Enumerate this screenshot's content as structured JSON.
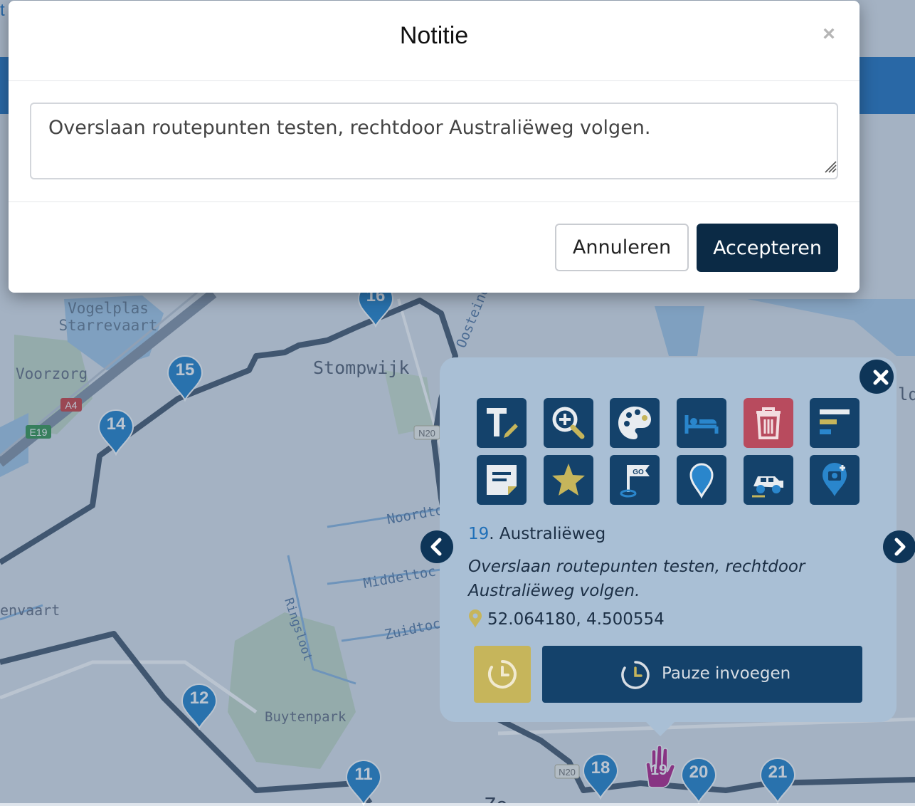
{
  "modal": {
    "title": "Notitie",
    "close_glyph": "×",
    "note_value": "Overslaan routepunten testen, rechtdoor Australiëweg volgen.",
    "cancel_label": "Annuleren",
    "accept_label": "Accepteren"
  },
  "map": {
    "place_labels": {
      "vogelplas_line1": "Vogelplas",
      "vogelplas_line2": "Starrevaart",
      "voorzorg": "Voorzorg",
      "stompwijk": "Stompwijk",
      "oosteinde": "Oosteind",
      "noordtocht": "Noordto",
      "middeltocht": "Middeltoc",
      "zuidtocht": "Zuidtoch",
      "ringsloot": "Ringsloot",
      "buytenpark": "Buytenpark",
      "venvaart": "envaart",
      "edge_ld": "ld",
      "zoet": "Zo"
    },
    "road_shields": {
      "a4": "A4",
      "e19": "E19",
      "n206a": "N20",
      "n206b": "N20"
    },
    "markers": [
      {
        "id": "16",
        "label": "16"
      },
      {
        "id": "15",
        "label": "15"
      },
      {
        "id": "14",
        "label": "14"
      },
      {
        "id": "12",
        "label": "12"
      },
      {
        "id": "11",
        "label": "11"
      },
      {
        "id": "18",
        "label": "18"
      },
      {
        "id": "19",
        "label": "19"
      },
      {
        "id": "20",
        "label": "20"
      },
      {
        "id": "21",
        "label": "21"
      }
    ],
    "top_left_char": "t"
  },
  "popup": {
    "tools": [
      {
        "name": "edit-text-icon"
      },
      {
        "name": "zoom-in-icon"
      },
      {
        "name": "palette-icon"
      },
      {
        "name": "bed-icon"
      },
      {
        "name": "trash-icon"
      },
      {
        "name": "bar-list-icon"
      },
      {
        "name": "note-icon"
      },
      {
        "name": "star-icon"
      },
      {
        "name": "go-flag-icon"
      },
      {
        "name": "map-pin-icon"
      },
      {
        "name": "offroad-jeep-icon"
      },
      {
        "name": "camera-pin-icon"
      }
    ],
    "waypoint_number": "19",
    "waypoint_sep": ".",
    "waypoint_name": " Australiëweg",
    "waypoint_note": "Overslaan routepunten testen, rechtdoor Australiëweg volgen.",
    "coordinates": "52.064180, 4.500554",
    "pause_label": "Pauze invoegen"
  },
  "colors": {
    "accent_dark": "#0b2a45",
    "tool_blue": "#14426b",
    "delete_red": "#b84b5e",
    "clock_gold": "#c6b55b",
    "marker_blue": "#2a86cc",
    "marker_pink": "#b52b8e"
  }
}
